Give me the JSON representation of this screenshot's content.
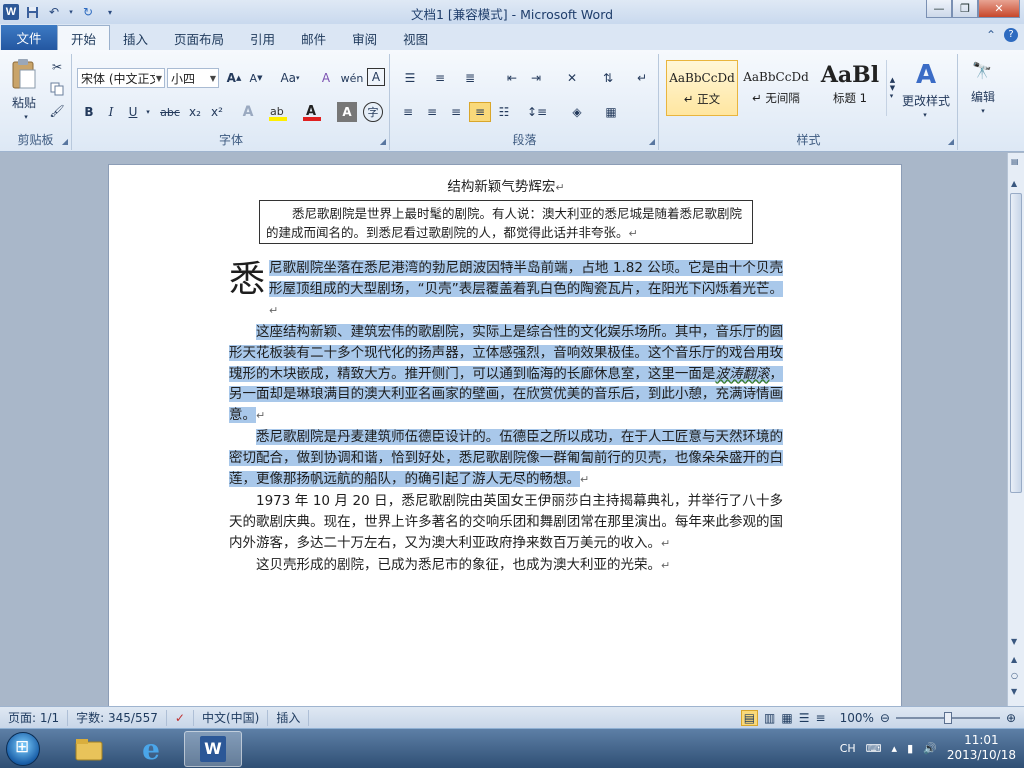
{
  "window": {
    "title": "文档1 [兼容模式] - Microsoft Word",
    "logo_letter": "W"
  },
  "tabs": {
    "file": "文件",
    "items": [
      "开始",
      "插入",
      "页面布局",
      "引用",
      "邮件",
      "审阅",
      "视图"
    ],
    "active_index": 0
  },
  "ribbon": {
    "clipboard": {
      "paste": "粘贴",
      "label": "剪贴板"
    },
    "font": {
      "font_name": "宋体 (中文正文)",
      "font_size": "小四",
      "grow_label": "A",
      "shrink_label": "A",
      "case_label": "Aa",
      "clear_label": "A",
      "pinyin_label": "wén",
      "border_char": "A",
      "bold": "B",
      "italic": "I",
      "underline": "U",
      "strike": "abc",
      "subscript": "x₂",
      "superscript": "x²",
      "label": "字体"
    },
    "paragraph": {
      "label": "段落"
    },
    "styles": {
      "label": "样式",
      "items": [
        {
          "sample": "AaBbCcDd",
          "name": "↵ 正文"
        },
        {
          "sample": "AaBbCcDd",
          "name": "↵ 无间隔"
        },
        {
          "sample": "AaBl",
          "name": "标题 1"
        }
      ],
      "change": "更改样式"
    },
    "editing": {
      "label": "编辑"
    }
  },
  "document": {
    "title": "结构新颖气势辉宏",
    "quote": "悉尼歌剧院是世界上最时髦的剧院。有人说：澳大利亚的悉尼城是随着悉尼歌剧院的建成而闻名的。到悉尼看过歌剧院的人，都觉得此话并非夸张。",
    "dropcap": "悉",
    "p1": "尼歌剧院坐落在悉尼港湾的勃尼朗波因特半岛前端，占地 1.82 公顷。它是由十个贝壳形屋顶组成的大型剧场，“贝壳”表层覆盖着乳白色的陶瓷瓦片，在阳光下闪烁着光芒。",
    "p2a": "这座结构新颖、建筑宏伟的歌剧院，实际上是综合性的文化娱乐场所。其中，音乐厅的圆形天花板装有二十多个现代化的扬声器，立体感强烈，音响效果极佳。这个音乐厅的戏台用玫瑰形的木块嵌成，精致大方。推开侧门，可以通到临海的长廊休息室，这里一面是",
    "p2wavy": "波涛翻滚",
    "p2b": "，另一面却是琳琅满目的澳大利亚名画家的壁画，在欣赏优美的音乐后，到此小憩，充满诗情画意。",
    "p3": "悉尼歌剧院是丹麦建筑师伍德臣设计的。伍德臣之所以成功，在于人工匠意与天然环境的密切配合，做到协调和谐，恰到好处，悉尼歌剧院像一群匍匐前行的贝壳，也像朵朵盛开的白莲，更像那扬帆远航的船队，的确引起了游人无尽的畅想。",
    "p4": "1973 年 10 月 20 日，悉尼歌剧院由英国女王伊丽莎白主持揭幕典礼，并举行了八十多天的歌剧庆典。现在，世界上许多著名的交响乐团和舞剧团常在那里演出。每年来此参观的国内外游客，多达二十万左右，又为澳大利亚政府挣来数百万美元的收入。",
    "p5": "这贝壳形成的剧院，已成为悉尼市的象征，也成为澳大利亚的光荣。",
    "para_mark": "↵"
  },
  "status": {
    "page": "页面: 1/1",
    "words": "字数: 345/557",
    "language": "中文(中国)",
    "mode": "插入",
    "zoom": "100%",
    "zoom_level": 0.5
  },
  "taskbar": {
    "ime": "CH",
    "time": "11:01",
    "date": "2013/10/18"
  }
}
